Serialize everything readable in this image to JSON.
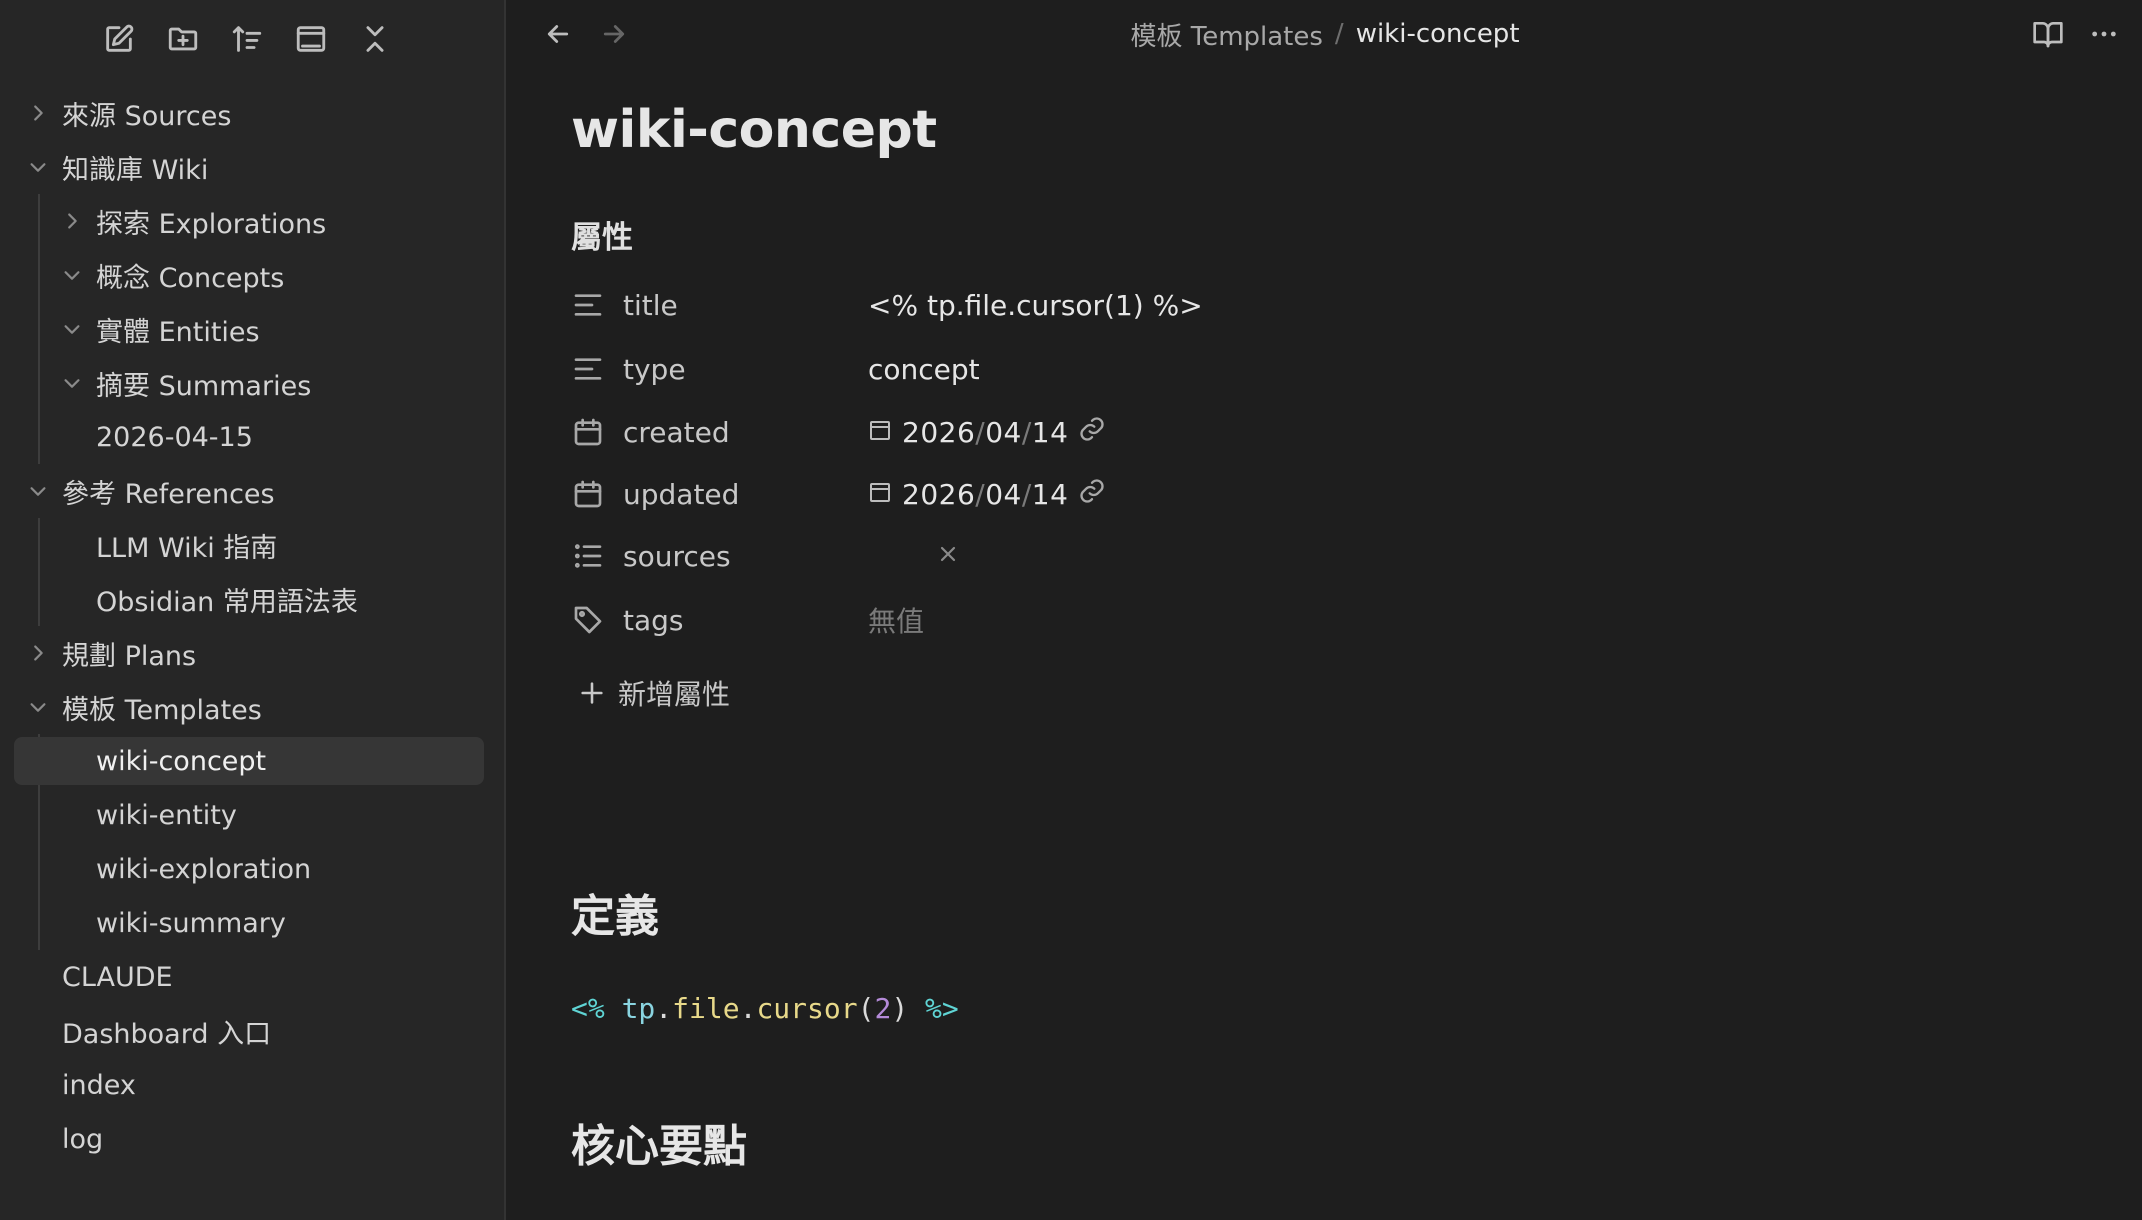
{
  "sidebar": {
    "toolbar": {
      "new_note_icon": "edit-icon",
      "new_folder_icon": "folder-plus-icon",
      "sort_icon": "sort-icon",
      "collapse_view_icon": "window-icon",
      "collapse_all_icon": "collapse-icon"
    },
    "tree": [
      {
        "label": "來源 Sources",
        "level": 0,
        "state": "collapsed"
      },
      {
        "label": "知識庫 Wiki",
        "level": 0,
        "state": "expanded"
      },
      {
        "label": "探索 Explorations",
        "level": 1,
        "state": "collapsed"
      },
      {
        "label": "概念 Concepts",
        "level": 1,
        "state": "expanded"
      },
      {
        "label": "實體 Entities",
        "level": 1,
        "state": "expanded"
      },
      {
        "label": "摘要 Summaries",
        "level": 1,
        "state": "expanded"
      },
      {
        "label": "2026-04-15",
        "level": 1,
        "state": "file"
      },
      {
        "label": "參考 References",
        "level": 0,
        "state": "expanded"
      },
      {
        "label": "LLM Wiki 指南",
        "level": 1,
        "state": "file"
      },
      {
        "label": "Obsidian 常用語法表",
        "level": 1,
        "state": "file"
      },
      {
        "label": "規劃 Plans",
        "level": 0,
        "state": "collapsed"
      },
      {
        "label": "模板 Templates",
        "level": 0,
        "state": "expanded"
      },
      {
        "label": "wiki-concept",
        "level": 1,
        "state": "file",
        "active": true
      },
      {
        "label": "wiki-entity",
        "level": 1,
        "state": "file"
      },
      {
        "label": "wiki-exploration",
        "level": 1,
        "state": "file"
      },
      {
        "label": "wiki-summary",
        "level": 1,
        "state": "file"
      },
      {
        "label": "CLAUDE",
        "level": 0,
        "state": "file"
      },
      {
        "label": "Dashboard 入口",
        "level": 0,
        "state": "file"
      },
      {
        "label": "index",
        "level": 0,
        "state": "file"
      },
      {
        "label": "log",
        "level": 0,
        "state": "file"
      }
    ]
  },
  "header": {
    "breadcrumb_parent": "模板 Templates",
    "breadcrumb_sep": "/",
    "breadcrumb_current": "wiki-concept"
  },
  "note": {
    "title": "wiki-concept",
    "properties_heading": "屬性",
    "properties": {
      "title": {
        "key": "title",
        "value": "<% tp.file.cursor(1) %>"
      },
      "type": {
        "key": "type",
        "value": "concept"
      },
      "created": {
        "key": "created",
        "year": "2026",
        "month": "04",
        "day": "14",
        "sep": "/"
      },
      "updated": {
        "key": "updated",
        "year": "2026",
        "month": "04",
        "day": "14",
        "sep": "/"
      },
      "sources": {
        "key": "sources"
      },
      "tags": {
        "key": "tags",
        "empty": "無值"
      }
    },
    "add_property_label": "新增屬性",
    "section1_heading": "定義",
    "code": {
      "open": "<%",
      "obj": "tp",
      "dot1": ".",
      "prop": "file",
      "dot2": ".",
      "method": "cursor",
      "paren_open": "(",
      "arg": "2",
      "paren_close": ")",
      "close": "%>"
    },
    "section2_heading": "核心要點"
  },
  "colors": {
    "bg_main": "#1e1e1e",
    "bg_sidebar": "#262626",
    "active_row": "#363636",
    "code_delim": "#5fd4d4",
    "code_ident": "#8ad4e0",
    "code_prop": "#e8d98a",
    "code_num": "#b48ad8",
    "code_punct": "#dadada"
  }
}
